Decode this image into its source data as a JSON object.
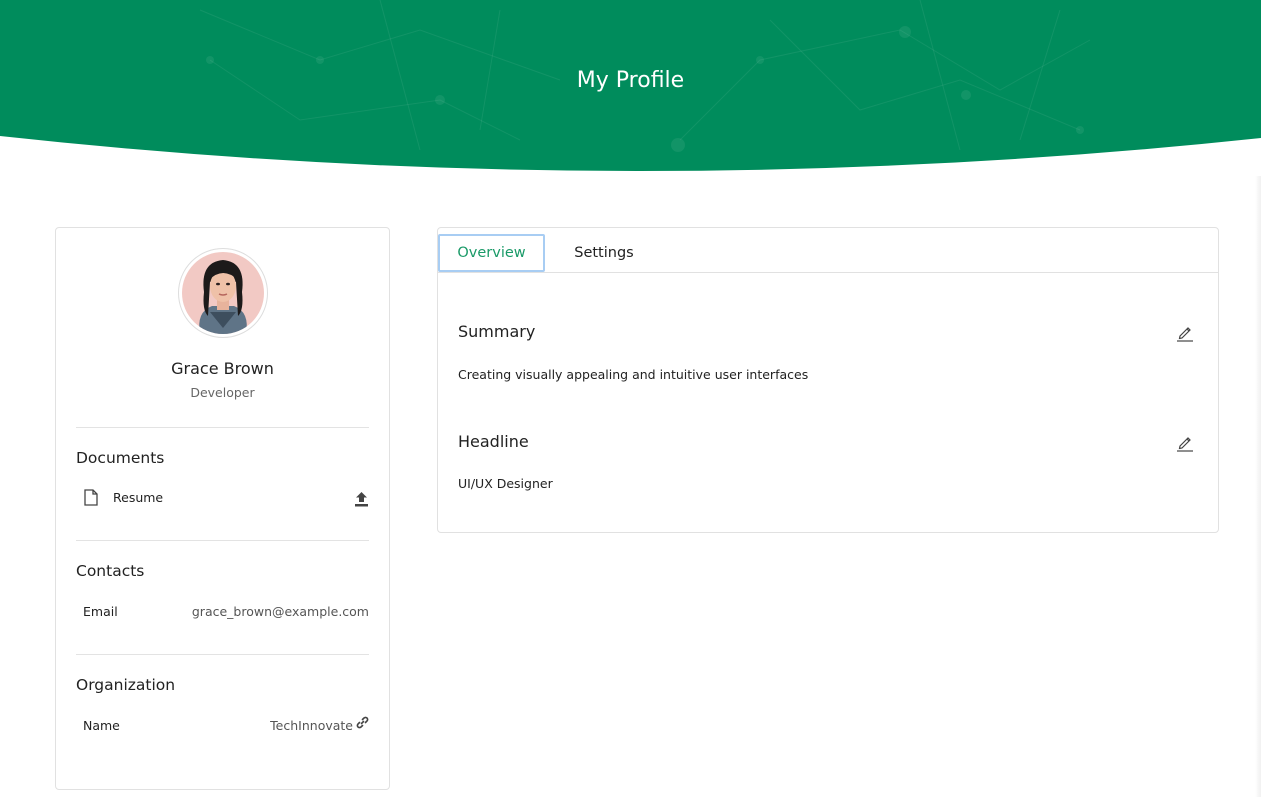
{
  "header": {
    "title": "My Profile",
    "brand_color": "#008c5c"
  },
  "profile": {
    "name": "Grace Brown",
    "role": "Developer",
    "avatar_icon": "avatar-photo"
  },
  "documents": {
    "title": "Documents",
    "items": [
      {
        "label": "Resume",
        "icon": "file-icon",
        "action_icon": "upload-icon"
      }
    ]
  },
  "contacts": {
    "title": "Contacts",
    "items": [
      {
        "label": "Email",
        "value": "grace_brown@example.com"
      }
    ]
  },
  "organization": {
    "title": "Organization",
    "items": [
      {
        "label": "Name",
        "value": "TechInnovate",
        "action_icon": "link-icon"
      }
    ]
  },
  "tabs": [
    {
      "label": "Overview",
      "active": true
    },
    {
      "label": "Settings",
      "active": false
    }
  ],
  "overview": {
    "summary": {
      "title": "Summary",
      "text": "Creating visually appealing and intuitive user interfaces",
      "action_icon": "pencil-icon"
    },
    "headline": {
      "title": "Headline",
      "text": "UI/UX Designer",
      "action_icon": "pencil-icon"
    }
  },
  "colors": {
    "accent": "#1a9a68",
    "tab_focus_border": "#a8cdf3"
  }
}
